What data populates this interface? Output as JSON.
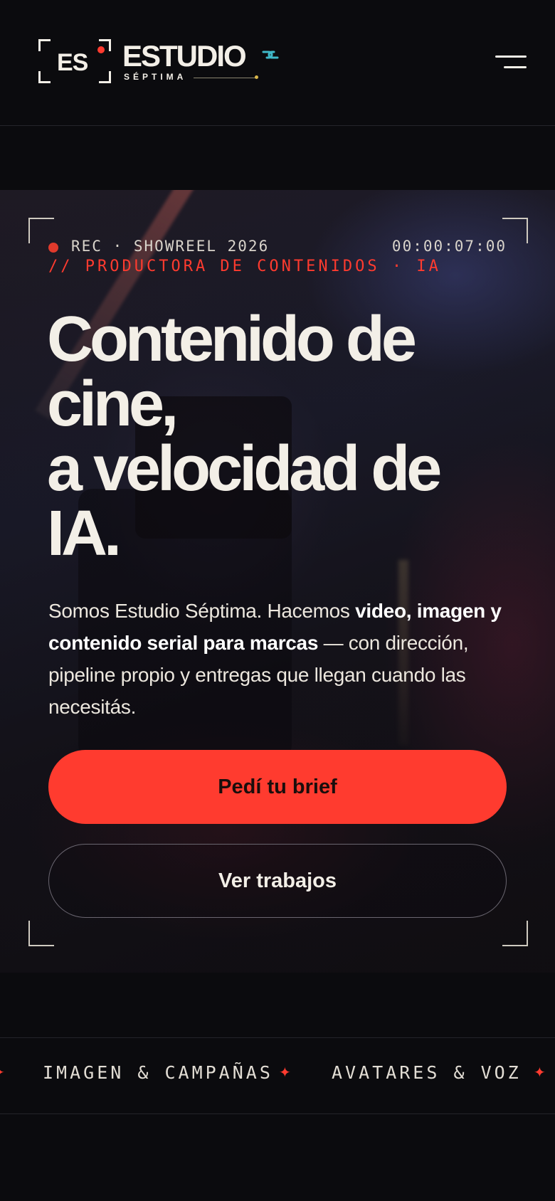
{
  "header": {
    "logo_mark": "ES",
    "logo_word": "ESTUDIO",
    "logo_sub": "SÉPTIMA",
    "menu_icon": "hamburger-menu-icon"
  },
  "hero": {
    "rec_label": "REC · SHOWREEL 2026",
    "timecode": "00:00:07:00",
    "kicker": "// PRODUCTORA DE CONTENIDOS · IA",
    "title_lines": [
      "Contenido de",
      "cine,",
      "a velocidad de",
      "IA."
    ],
    "description": {
      "part1": "Somos Estudio Séptima. Hacemos ",
      "bold": "video, imagen y contenido serial para marcas",
      "part2": " — con dirección, pipeline propio y entregas que llegan cuando las necesitás."
    },
    "primary_cta": "Pedí tu brief",
    "secondary_cta": "Ver trabajos"
  },
  "marquee": {
    "items": [
      "IMAGEN & CAMPAÑAS",
      "AVATARES & VOZ"
    ],
    "separator": "✦"
  },
  "colors": {
    "background": "#0b0b0e",
    "accent": "#ff3b2f",
    "text": "#f3efe7",
    "logo_link_accent": "#3fb8c8"
  }
}
